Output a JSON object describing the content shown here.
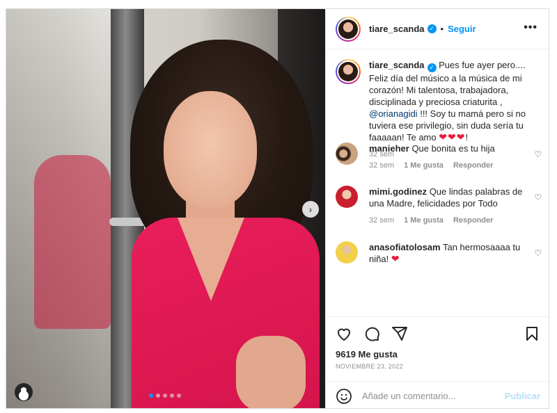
{
  "post": {
    "username": "tiare_scanda",
    "follow_label": "Seguir",
    "more_label": "•••"
  },
  "caption": {
    "username": "tiare_scanda",
    "text_before_mention": "Pues fue ayer pero.... Feliz día del músico a la música de mi corazón! Mi talentosa, trabajadora, disciplinada y preciosa criaturita ,",
    "mention": "@orianagidi",
    "text_after_mention": "!!! Soy tu mamá pero si no tuviera ese privilegio, sin duda sería tu faaaaan! Te amo",
    "hearts": "❤❤❤",
    "end": "!",
    "time": "32 sem"
  },
  "comments": [
    {
      "username": "manieher",
      "text": "Que bonita es tu hija",
      "time": "32 sem",
      "likes": "1 Me gusta",
      "reply": "Responder"
    },
    {
      "username": "mimi.godinez",
      "text": "Que lindas palabras de una Madre, felicidades por Todo",
      "time": "32 sem",
      "likes": "1 Me gusta",
      "reply": "Responder"
    },
    {
      "username": "anasofiatolosam",
      "text": "Tan hermosaaaa tu niña!",
      "heart": "❤"
    }
  ],
  "actions": {
    "likes": "9619 Me gusta",
    "date": "NOVIEMBRE 23, 2022",
    "comment_placeholder": "Añade un comentario...",
    "publish_label": "Publicar"
  },
  "colors": {
    "accent": "#0095f6",
    "heart": "#ed1a3a",
    "shirt": "#e91e5a"
  },
  "icons": [
    "user-tag-icon",
    "chevron-right-icon",
    "verified-icon",
    "more-icon",
    "heart-icon",
    "comment-icon",
    "share-icon",
    "bookmark-icon",
    "emoji-icon"
  ]
}
